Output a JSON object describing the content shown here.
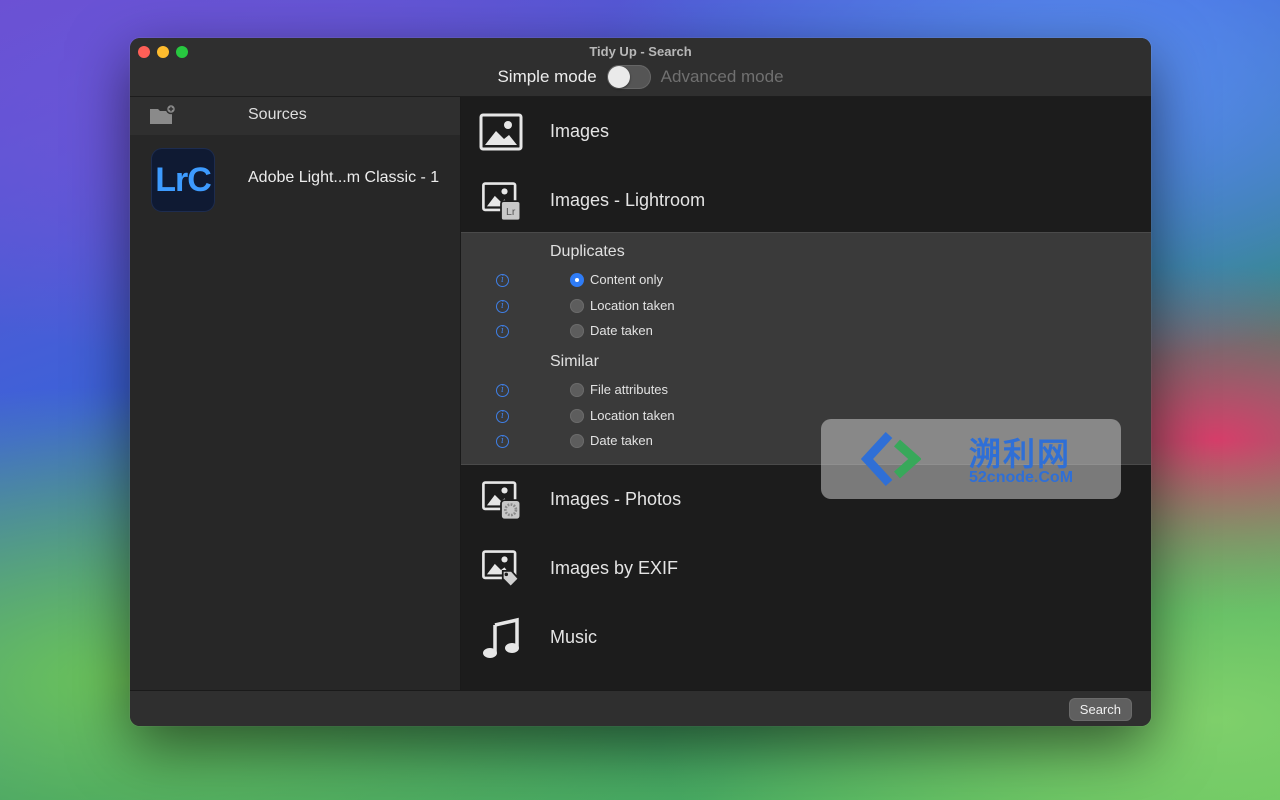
{
  "window": {
    "title": "Tidy Up - Search",
    "mode_simple_label": "Simple mode",
    "mode_advanced_label": "Advanced mode",
    "advanced_mode_on": false
  },
  "sidebar": {
    "header_label": "Sources",
    "sources": [
      {
        "icon_text": "LrC",
        "label": "Adobe Light...m Classic - 1"
      }
    ]
  },
  "categories": [
    {
      "label": "Images",
      "icon": "image-icon"
    },
    {
      "label": "Images - Lightroom",
      "icon": "image-lightroom-icon"
    },
    {
      "label": "Images - Photos",
      "icon": "image-photos-icon"
    },
    {
      "label": "Images by EXIF",
      "icon": "image-exif-icon"
    },
    {
      "label": "Music",
      "icon": "music-icon"
    }
  ],
  "options": {
    "duplicates_title": "Duplicates",
    "duplicates": [
      {
        "label": "Content only",
        "selected": true
      },
      {
        "label": "Location taken",
        "selected": false
      },
      {
        "label": "Date taken",
        "selected": false
      }
    ],
    "similar_title": "Similar",
    "similar": [
      {
        "label": "File attributes",
        "selected": false
      },
      {
        "label": "Location taken",
        "selected": false
      },
      {
        "label": "Date taken",
        "selected": false
      }
    ]
  },
  "watermark": {
    "text_cn": "溯利网",
    "text_url": "52cnode.CoM"
  },
  "footer": {
    "search_label": "Search"
  },
  "colors": {
    "accent": "#2f7cf6",
    "info": "#3f7fe6",
    "lrc_blue": "#3d9bff"
  }
}
